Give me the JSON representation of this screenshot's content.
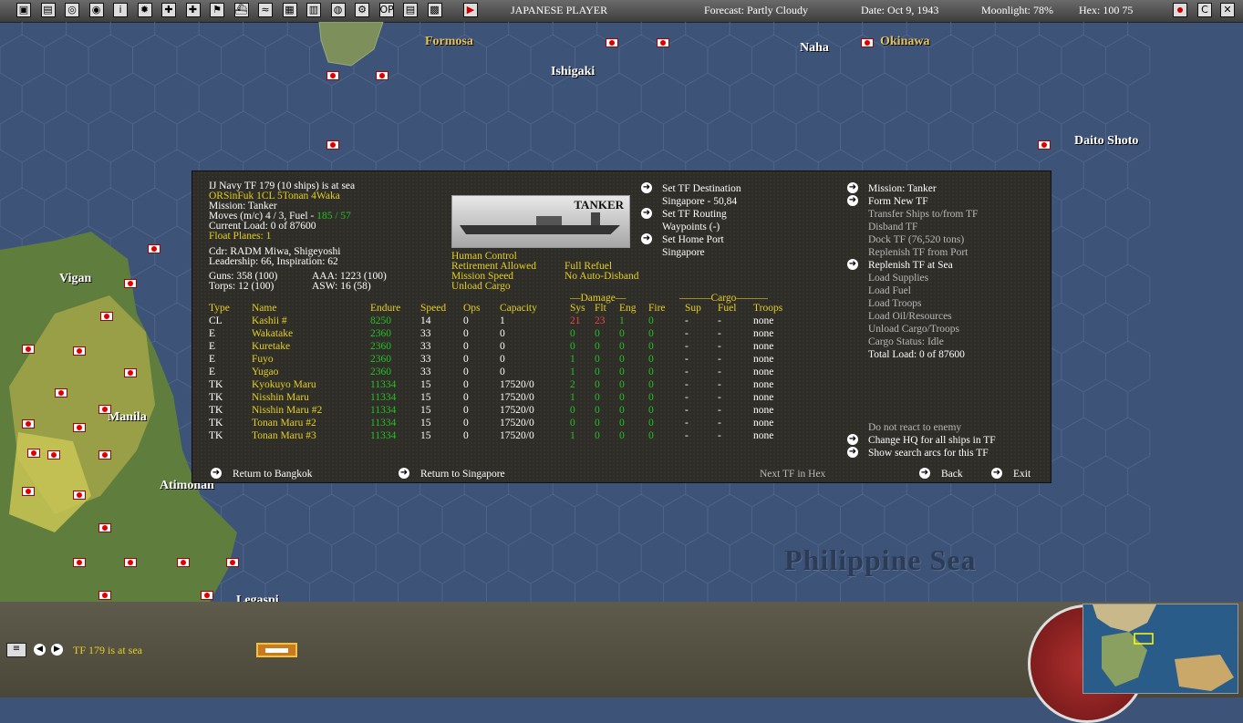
{
  "topbar": {
    "player": "JAPANESE PLAYER",
    "forecast": "Forecast: Partly Cloudy",
    "date": "Date: Oct 9, 1943",
    "moonlight": "Moonlight: 78%",
    "hex": "Hex: 100 75",
    "icons_left": [
      "map-icon",
      "report-icon",
      "list-icon",
      "intel-icon",
      "info-icon",
      "flag-icon",
      "medical-icon",
      "air-icon",
      "flag2-icon",
      "ship-icon",
      "wave-icon",
      "chart-icon",
      "group-icon",
      "globe-icon",
      "gear-icon",
      "op-icon",
      "table-icon",
      "photo-icon",
      "play-icon"
    ],
    "icons_right": [
      "japan-flag-icon",
      "c-icon",
      "close-icon"
    ]
  },
  "map": {
    "labels": [
      {
        "text": "Formosa",
        "style": "yellow"
      },
      {
        "text": "Ishigaki",
        "style": "white"
      },
      {
        "text": "Naha",
        "style": "white"
      },
      {
        "text": "Okinawa",
        "style": "yellow"
      },
      {
        "text": "Daito Shoto",
        "style": "white"
      },
      {
        "text": "Vigan",
        "style": "white"
      },
      {
        "text": "Manila",
        "style": "white"
      },
      {
        "text": "Atimonan",
        "style": "white"
      },
      {
        "text": "Legaspi",
        "style": "white"
      }
    ],
    "sea_label": "Philippine Sea"
  },
  "panel": {
    "left_info": {
      "title": "IJ Navy TF 179 (10 ships) is at sea",
      "composition": "ORSinFuk 1CL 5Tonan 4Waka",
      "mission": "Mission: Tanker",
      "moves_prefix": "Moves (m/c) 4 / 3, Fuel - ",
      "moves_fuel": "185 / 57",
      "load": "Current Load: 0 of 87600",
      "float_planes": "Float Planes: 1",
      "cdr": "Cdr: RADM Miwa, Shigeyoshi",
      "leadership": "Leadership: 66, Inspiration: 62",
      "guns": "Guns: 358 (100)",
      "aaa": "AAA: 1223 (100)",
      "torps": "Torps: 12 (100)",
      "asw": "ASW: 16 (58)"
    },
    "image_label": "TANKER",
    "control": {
      "human_control": "Human Control",
      "retirement": "Retirement Allowed",
      "mission_speed": "Mission Speed",
      "unload_cargo": "Unload Cargo",
      "full_refuel": "Full Refuel",
      "no_auto_disband": "No Auto-Disband"
    },
    "middle_commands": {
      "set_destination": "Set TF Destination",
      "destination_value": "Singapore - 50,84",
      "set_routing": "Set TF Routing",
      "waypoints": "Waypoints (-)",
      "set_home_port": "Set Home Port",
      "home_port_value": "Singapore"
    },
    "right_commands": {
      "mission": "Mission: Tanker",
      "form_new_tf": "Form New TF",
      "transfer_ships": "Transfer Ships to/from TF",
      "disband_tf": "Disband TF",
      "dock_tf": "Dock TF (76,520 tons)",
      "replenish_port": "Replenish TF from Port",
      "replenish_sea": "Replenish TF at Sea",
      "load_supplies": "Load Supplies",
      "load_fuel": "Load Fuel",
      "load_troops": "Load Troops",
      "load_oil": "Load Oil/Resources",
      "unload_cargo_troops": "Unload Cargo/Troops",
      "cargo_status": "Cargo Status: Idle",
      "total_load": "Total Load: 0 of 87600",
      "do_not_react": "Do not react to enemy",
      "change_hq": "Change HQ for all ships in TF",
      "show_search": "Show search arcs for this TF"
    },
    "table": {
      "group_damage": "Damage",
      "group_cargo": "Cargo",
      "columns": [
        "Type",
        "Name",
        "Endure",
        "Speed",
        "Ops",
        "Capacity",
        "Sys",
        "Flt",
        "Eng",
        "Fire",
        "Sup",
        "Fuel",
        "Troops"
      ],
      "rows": [
        [
          "CL",
          "Kashii #",
          "8250",
          "14",
          "0",
          "1",
          "21",
          "23",
          "1",
          "0",
          "-",
          "-",
          "none"
        ],
        [
          "E",
          "Wakatake",
          "2360",
          "33",
          "0",
          "0",
          "0",
          "0",
          "0",
          "0",
          "-",
          "-",
          "none"
        ],
        [
          "E",
          "Kuretake",
          "2360",
          "33",
          "0",
          "0",
          "0",
          "0",
          "0",
          "0",
          "-",
          "-",
          "none"
        ],
        [
          "E",
          "Fuyo",
          "2360",
          "33",
          "0",
          "0",
          "1",
          "0",
          "0",
          "0",
          "-",
          "-",
          "none"
        ],
        [
          "E",
          "Yugao",
          "2360",
          "33",
          "0",
          "0",
          "1",
          "0",
          "0",
          "0",
          "-",
          "-",
          "none"
        ],
        [
          "TK",
          "Kyokuyo Maru",
          "11334",
          "15",
          "0",
          "17520/0",
          "2",
          "0",
          "0",
          "0",
          "-",
          "-",
          "none"
        ],
        [
          "TK",
          "Nisshin Maru",
          "11334",
          "15",
          "0",
          "17520/0",
          "1",
          "0",
          "0",
          "0",
          "-",
          "-",
          "none"
        ],
        [
          "TK",
          "Nisshin Maru #2",
          "11334",
          "15",
          "0",
          "17520/0",
          "0",
          "0",
          "0",
          "0",
          "-",
          "-",
          "none"
        ],
        [
          "TK",
          "Tonan Maru #2",
          "11334",
          "15",
          "0",
          "17520/0",
          "0",
          "0",
          "0",
          "0",
          "-",
          "-",
          "none"
        ],
        [
          "TK",
          "Tonan Maru #3",
          "11334",
          "15",
          "0",
          "17520/0",
          "1",
          "0",
          "0",
          "0",
          "-",
          "-",
          "none"
        ]
      ]
    },
    "footer": {
      "return_bangkok": "Return to Bangkok",
      "return_singapore": "Return to Singapore",
      "next_tf": "Next TF in Hex",
      "back": "Back",
      "exit": "Exit"
    }
  },
  "bottom": {
    "status": "TF 179 is at sea"
  },
  "colors": {
    "sea": "#3d5378",
    "panel": "#2e2d27",
    "yellow_text": "#e6d020",
    "green_text": "#22c322",
    "red_text": "#ef4444"
  }
}
